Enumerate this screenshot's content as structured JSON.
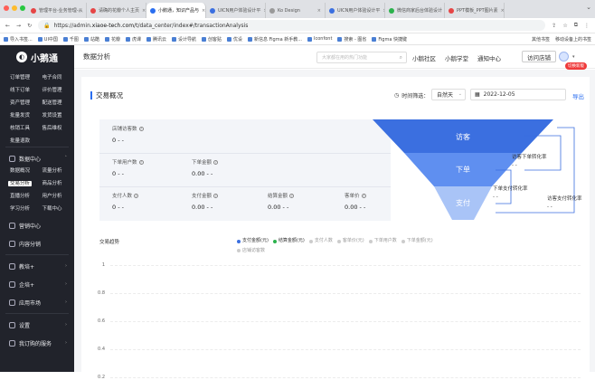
{
  "browser": {
    "tabs": [
      {
        "label": "管理平台-业务管理-从",
        "color": "#e64545",
        "active": false
      },
      {
        "label": "请确的花瓣个人主页",
        "color": "#e64545",
        "active": false
      },
      {
        "label": "小鹅通，知识产品与",
        "color": "#2a6ef0",
        "active": true
      },
      {
        "label": "UICN用户体验设计平",
        "color": "#3b6fe0",
        "active": false
      },
      {
        "label": "Ko Design",
        "color": "#999999",
        "active": false
      },
      {
        "label": "UICN用户体验设计平",
        "color": "#3b6fe0",
        "active": false
      },
      {
        "label": "微信商家后台体验设计",
        "color": "#2bb24c",
        "active": false
      },
      {
        "label": "PPT模板_PPT图片素",
        "color": "#e64545",
        "active": false
      }
    ],
    "url_prefix": "https://admin.",
    "url_domain": "xiaoe-tech.com",
    "url_path": "/t/data_center/index#/transactionAnalysis",
    "bookmarks": [
      "导入书签...",
      "UI中国",
      "千图",
      "站酷",
      "花瓣",
      "虎课",
      "腾讯云",
      "设计导航",
      "创客贴",
      "优设",
      "新信息 Figma 新手教...",
      "Iconfont",
      "搜索 - 图省",
      "Figma 快捷键"
    ],
    "bookmarks_right": [
      "其他书签",
      "移动设备上的书签"
    ]
  },
  "sidebar": {
    "brand": "小鹅通",
    "top_links": [
      "订单管理",
      "电子合同",
      "线下订单",
      "评价管理",
      "资产管理",
      "配送管理",
      "批量发货",
      "发货设置",
      "核销工具",
      "售后维权",
      "批量退款"
    ],
    "data_center": "数据中心",
    "data_links": [
      "数据概况",
      "流量分析",
      "交易分析",
      "商品分析",
      "直播分析",
      "用户分析",
      "学习分析",
      "下载中心"
    ],
    "selected": "交易分析",
    "sections": [
      "营销中心",
      "内容分销",
      "教培+",
      "企培+",
      "应用市场",
      "设置",
      "我订购的服务"
    ]
  },
  "topbar": {
    "page_title": "数据分析",
    "search_placeholder": "大家都在用的热门功能",
    "links": [
      "小鹅社区",
      "小鹅学堂",
      "通知中心"
    ],
    "visit_store": "访问店铺",
    "switch_version": "切换新版"
  },
  "overview": {
    "title": "交易概况",
    "time_filter_label": "时间筛选：",
    "time_option": "自然天",
    "date": "2022-12-05",
    "export": "导出",
    "metrics": [
      {
        "label": "店铺访客数",
        "value": "0 - -"
      },
      {
        "label": "下单用户数",
        "value": "0 - -"
      },
      {
        "label": "下单金额",
        "value": "0.00 - -"
      },
      {
        "label": "支付人数",
        "value": "0 - -"
      },
      {
        "label": "支付金额",
        "value": "0.00 - -"
      },
      {
        "label": "结算金额",
        "value": "0.00 - -"
      },
      {
        "label": "客单价",
        "value": "0.00 - -"
      }
    ],
    "funnel": [
      "访客",
      "下单",
      "支付"
    ],
    "rates": [
      {
        "label": "访客下单转化率",
        "value": "- -"
      },
      {
        "label": "下单支付转化率",
        "value": "- -"
      },
      {
        "label": "访客支付转化率",
        "value": "- -"
      }
    ]
  },
  "trend": {
    "title": "交易趋势",
    "legend": [
      {
        "label": "支付金额(元)",
        "on": true,
        "color": "#3b6fe0"
      },
      {
        "label": "结算金额(元)",
        "on": true,
        "color": "#2bb24c"
      },
      {
        "label": "支付人数",
        "on": false,
        "color": "#cccccc"
      },
      {
        "label": "客单价(元)",
        "on": false,
        "color": "#cccccc"
      },
      {
        "label": "下单用户数",
        "on": false,
        "color": "#cccccc"
      },
      {
        "label": "下单金额(元)",
        "on": false,
        "color": "#cccccc"
      },
      {
        "label": "店铺访客数",
        "on": false,
        "color": "#cccccc"
      }
    ],
    "y_ticks": [
      "1",
      "0.8",
      "0.6",
      "0.4",
      "0.2"
    ]
  }
}
